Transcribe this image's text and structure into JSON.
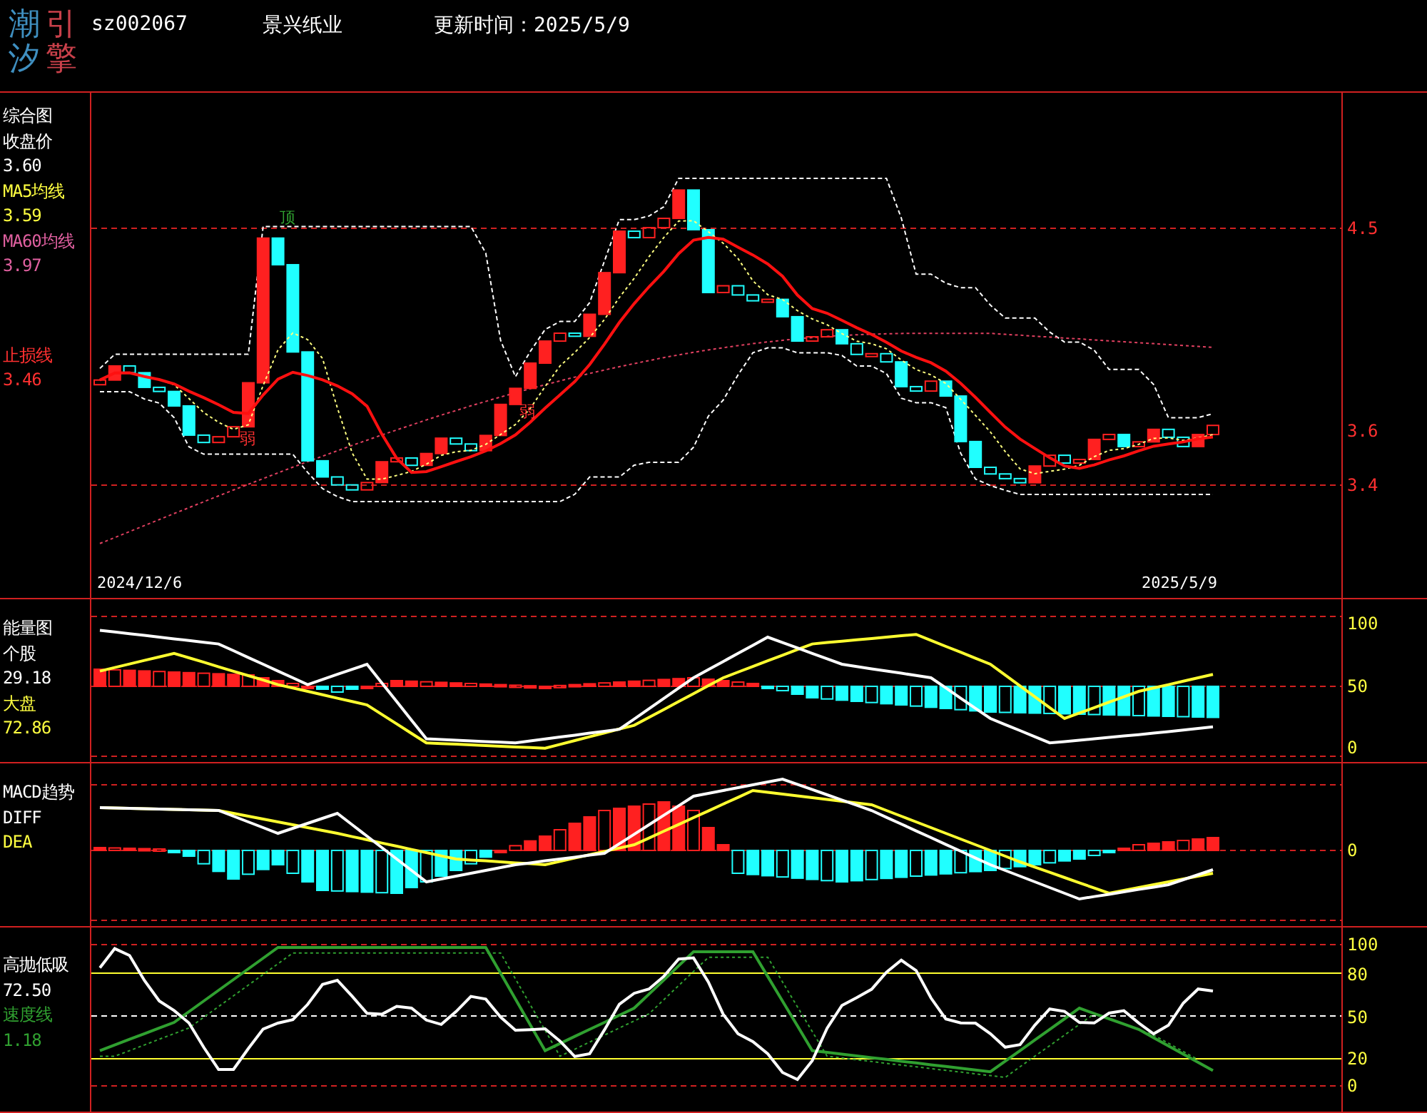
{
  "header": {
    "logo": [
      {
        "text": "潮汐",
        "color": "#3f8fc0"
      },
      {
        "text": "引擎",
        "color": "#c8404a"
      }
    ],
    "code": "sz002067",
    "name": "景兴纸业",
    "update_time": "更新时间：2025/5/9"
  },
  "panels": [
    {
      "kind": "price",
      "legend": [
        [
          {
            "text": "综合图",
            "color": "#ffffff"
          },
          {
            "text": "收盘价",
            "color": "#ffffff"
          },
          {
            "text": "3.60",
            "color": "#ffffff"
          },
          {
            "text": "MA5均线",
            "color": "#ffff40"
          },
          {
            "text": "3.59",
            "color": "#ffff40"
          },
          {
            "text": "MA60均线",
            "color": "#e060a0"
          },
          {
            "text": "3.97",
            "color": "#e060a0"
          }
        ],
        [
          {
            "text": "止损线",
            "color": "#ff3030"
          },
          {
            "text": "3.46",
            "color": "#ff3030"
          }
        ]
      ],
      "axis_ticks": [
        "4.5",
        "3.6",
        "3.4"
      ],
      "dates": [
        "2024/12/6",
        "2025/5/9"
      ],
      "signals": [
        "顶",
        "弱",
        "弱"
      ]
    },
    {
      "kind": "energy",
      "legend": [
        [
          {
            "text": "能量图",
            "color": "#ffffff"
          },
          {
            "text": "个股",
            "color": "#ffffff"
          },
          {
            "text": "29.18",
            "color": "#ffffff"
          },
          {
            "text": "大盘",
            "color": "#ffff40"
          },
          {
            "text": "72.86",
            "color": "#ffff40"
          }
        ]
      ],
      "axis_ticks": [
        "100",
        "50",
        "0"
      ]
    },
    {
      "kind": "macd",
      "legend": [
        [
          {
            "text": "MACD趋势",
            "color": "#ffffff"
          },
          {
            "text": "DIFF",
            "color": "#ffffff"
          },
          {
            "text": "DEA",
            "color": "#ffff40"
          }
        ]
      ],
      "axis_ticks": [
        "0"
      ]
    },
    {
      "kind": "oscillator",
      "legend": [
        [
          {
            "text": "高抛低吸",
            "color": "#ffffff"
          },
          {
            "text": "72.50",
            "color": "#ffffff"
          },
          {
            "text": "速度线",
            "color": "#30a030"
          },
          {
            "text": "1.18",
            "color": "#30a030"
          }
        ]
      ],
      "axis_ticks": [
        "100",
        "80",
        "50",
        "20",
        "0"
      ]
    }
  ]
}
